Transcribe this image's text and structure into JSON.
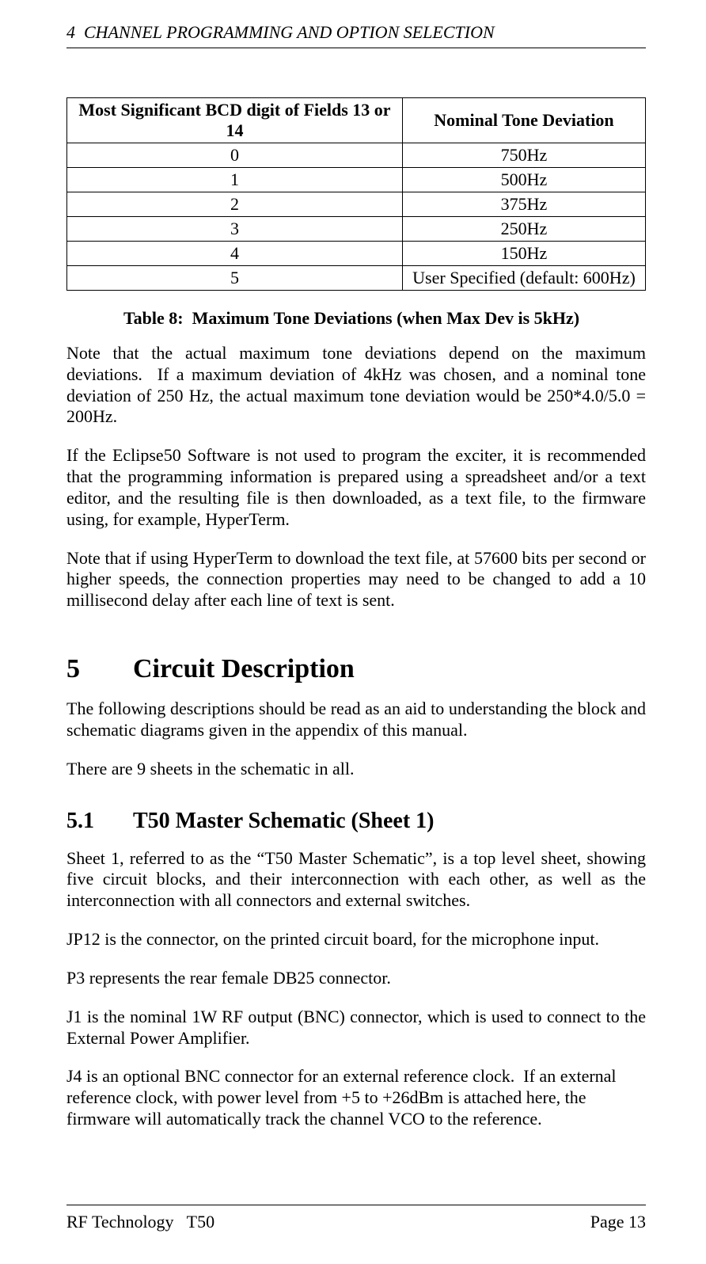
{
  "header": {
    "running_head": "4  CHANNEL PROGRAMMING AND OPTION SELECTION"
  },
  "table8": {
    "col1_header": "Most Significant BCD digit of Fields 13 or 14",
    "col2_header": "Nominal Tone Deviation",
    "rows": [
      {
        "c1": "0",
        "c2": "750Hz"
      },
      {
        "c1": "1",
        "c2": "500Hz"
      },
      {
        "c1": "2",
        "c2": "375Hz"
      },
      {
        "c1": "3",
        "c2": "250Hz"
      },
      {
        "c1": "4",
        "c2": "150Hz"
      },
      {
        "c1": "5",
        "c2": "User Specified (default: 600Hz)"
      }
    ],
    "caption": "Table 8:  Maximum Tone Deviations (when Max Dev is 5kHz)"
  },
  "paras": {
    "p1": "Note that the actual maximum tone deviations depend on the maximum deviations.  If a maximum deviation of 4kHz was chosen, and a nominal tone deviation of 250 Hz, the actual maximum tone deviation would be 250*4.0/5.0 = 200Hz.",
    "p2": "If the Eclipse50 Software is not used to program the exciter, it is recommended that the programming information is prepared using a spreadsheet and/or a text editor, and the resulting file is then downloaded, as a text file, to the firmware using, for example, HyperTerm.",
    "p3": "Note that if using HyperTerm to download the text file, at 57600 bits per second or higher speeds, the connection properties may need to be changed to add a 10 millisecond delay after each line of text is sent."
  },
  "section5": {
    "num": "5",
    "title": "Circuit Description",
    "p1": "The following descriptions should be read as an aid to understanding the block and schematic diagrams given in the appendix of this manual.",
    "p2": "There are 9 sheets in the schematic in all."
  },
  "section5_1": {
    "num": "5.1",
    "title": "T50 Master Schematic (Sheet 1)",
    "p1": "Sheet 1, referred to as the “T50 Master Schematic”, is a top level sheet, showing five circuit blocks, and their interconnection with each other, as well as the interconnection with all connectors and external switches.",
    "p2": "JP12 is the connector, on the printed circuit board, for the microphone input.",
    "p3": "P3 represents the rear female DB25 connector.",
    "p4": "J1 is the nominal 1W RF output (BNC) connector, which is used to connect to the External Power Amplifier.",
    "p5": "J4 is an optional BNC connector for an external reference clock.  If an external reference clock, with power level from +5 to +26dBm is attached here, the firmware will automatically track the channel VCO to the reference."
  },
  "footer": {
    "left": "RF Technology   T50",
    "right": "Page 13"
  }
}
